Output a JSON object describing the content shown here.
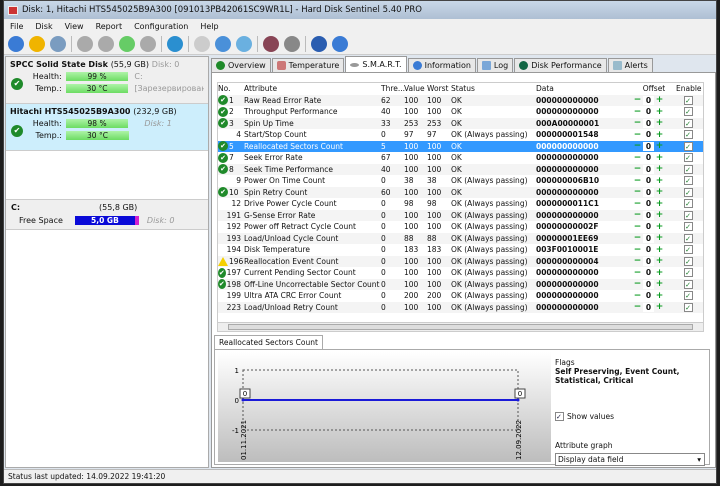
{
  "window": {
    "title": "Disk: 1, Hitachi HTS545025B9A300 [091013PB42061SC9WR1L]  -  Hard Disk Sentinel 5.40 PRO"
  },
  "menu": [
    "File",
    "Disk",
    "View",
    "Report",
    "Configuration",
    "Help"
  ],
  "toolbar_icons": [
    "refresh-icon",
    "alert-icon",
    "disk-icon",
    "disk-test-icon",
    "disk-test-2-icon",
    "disk-ok-icon",
    "disk-remove-icon",
    "globe-icon",
    "document-icon",
    "sync-icon",
    "network-icon",
    "monitor-icon",
    "sound-icon",
    "help-icon",
    "info-icon"
  ],
  "disks": [
    {
      "name": "SPCC Solid State Disk",
      "size": "(55,9 GB)",
      "disk": "Disk: 0",
      "health_label": "Health:",
      "health": "99 %",
      "health_pct": 99,
      "temp_label": "Temp.:",
      "temp": "30 °C",
      "extra1": "C:",
      "extra2": "[Зарезервировано сис"
    },
    {
      "name": "Hitachi HTS545025B9A300",
      "size": "(232,9 GB)",
      "disk": "Disk: 1",
      "health_label": "Health:",
      "health": "98 %",
      "health_pct": 98,
      "temp_label": "Temp.:",
      "temp": "30 °C"
    }
  ],
  "volume": {
    "name": "C:",
    "size": "(55,8 GB)",
    "free_label": "Free Space",
    "free": "5,0 GB",
    "disk": "Disk: 0"
  },
  "tabs": [
    "Overview",
    "Temperature",
    "S.M.A.R.T.",
    "Information",
    "Log",
    "Disk Performance",
    "Alerts"
  ],
  "active_tab": "S.M.A.R.T.",
  "table": {
    "headers": [
      "No.",
      "Attribute",
      "Thre...",
      "Value",
      "Worst",
      "Status",
      "Data",
      "Offset",
      "Enable"
    ],
    "rows": [
      {
        "icon": "ok",
        "no": "1",
        "attr": "Raw Read Error Rate",
        "thr": "62",
        "val": "100",
        "worst": "100",
        "status": "OK",
        "data": "000000000000",
        "offset": "0"
      },
      {
        "icon": "ok",
        "no": "2",
        "attr": "Throughput Performance",
        "thr": "40",
        "val": "100",
        "worst": "100",
        "status": "OK",
        "data": "000000000000",
        "offset": "0"
      },
      {
        "icon": "ok",
        "no": "3",
        "attr": "Spin Up Time",
        "thr": "33",
        "val": "253",
        "worst": "253",
        "status": "OK",
        "data": "000A00000001",
        "offset": "0"
      },
      {
        "icon": "",
        "no": "4",
        "attr": "Start/Stop Count",
        "thr": "0",
        "val": "97",
        "worst": "97",
        "status": "OK (Always passing)",
        "data": "000000001548",
        "offset": "0"
      },
      {
        "icon": "ok",
        "no": "5",
        "attr": "Reallocated Sectors Count",
        "thr": "5",
        "val": "100",
        "worst": "100",
        "status": "OK",
        "data": "000000000000",
        "offset": "0",
        "selected": true
      },
      {
        "icon": "ok",
        "no": "7",
        "attr": "Seek Error Rate",
        "thr": "67",
        "val": "100",
        "worst": "100",
        "status": "OK",
        "data": "000000000000",
        "offset": "0"
      },
      {
        "icon": "ok",
        "no": "8",
        "attr": "Seek Time Performance",
        "thr": "40",
        "val": "100",
        "worst": "100",
        "status": "OK",
        "data": "000000000000",
        "offset": "0"
      },
      {
        "icon": "",
        "no": "9",
        "attr": "Power On Time Count",
        "thr": "0",
        "val": "38",
        "worst": "38",
        "status": "OK (Always passing)",
        "data": "000000006B10",
        "offset": "0"
      },
      {
        "icon": "ok",
        "no": "10",
        "attr": "Spin Retry Count",
        "thr": "60",
        "val": "100",
        "worst": "100",
        "status": "OK",
        "data": "000000000000",
        "offset": "0"
      },
      {
        "icon": "",
        "no": "12",
        "attr": "Drive Power Cycle Count",
        "thr": "0",
        "val": "98",
        "worst": "98",
        "status": "OK (Always passing)",
        "data": "0000000011C1",
        "offset": "0"
      },
      {
        "icon": "",
        "no": "191",
        "attr": "G-Sense Error Rate",
        "thr": "0",
        "val": "100",
        "worst": "100",
        "status": "OK (Always passing)",
        "data": "000000000000",
        "offset": "0"
      },
      {
        "icon": "",
        "no": "192",
        "attr": "Power off Retract Cycle Count",
        "thr": "0",
        "val": "100",
        "worst": "100",
        "status": "OK (Always passing)",
        "data": "00000000002F",
        "offset": "0"
      },
      {
        "icon": "",
        "no": "193",
        "attr": "Load/Unload Cycle Count",
        "thr": "0",
        "val": "88",
        "worst": "88",
        "status": "OK (Always passing)",
        "data": "00000001EE69",
        "offset": "0"
      },
      {
        "icon": "",
        "no": "194",
        "attr": "Disk Temperature",
        "thr": "0",
        "val": "183",
        "worst": "183",
        "status": "OK (Always passing)",
        "data": "003F0010001E",
        "offset": "0"
      },
      {
        "icon": "warn",
        "no": "196",
        "attr": "Reallocation Event Count",
        "thr": "0",
        "val": "100",
        "worst": "100",
        "status": "OK (Always passing)",
        "data": "000000000004",
        "offset": "0"
      },
      {
        "icon": "ok",
        "no": "197",
        "attr": "Current Pending Sector Count",
        "thr": "0",
        "val": "100",
        "worst": "100",
        "status": "OK (Always passing)",
        "data": "000000000000",
        "offset": "0"
      },
      {
        "icon": "ok",
        "no": "198",
        "attr": "Off-Line Uncorrectable Sector Count",
        "thr": "0",
        "val": "100",
        "worst": "100",
        "status": "OK (Always passing)",
        "data": "000000000000",
        "offset": "0"
      },
      {
        "icon": "",
        "no": "199",
        "attr": "Ultra ATA CRC Error Count",
        "thr": "0",
        "val": "200",
        "worst": "200",
        "status": "OK (Always passing)",
        "data": "000000000000",
        "offset": "0"
      },
      {
        "icon": "",
        "no": "223",
        "attr": "Load/Unload Retry Count",
        "thr": "0",
        "val": "100",
        "worst": "100",
        "status": "OK (Always passing)",
        "data": "000000000000",
        "offset": "0"
      }
    ]
  },
  "graph": {
    "tab": "Reallocated Sectors Count",
    "y_ticks": [
      "1",
      "0",
      "-1"
    ],
    "x_labels": [
      "01.11.2021",
      "12.09.2022"
    ],
    "points": [
      {
        "date": "01.11.2021",
        "value": "0"
      },
      {
        "date": "12.09.2022",
        "value": "0"
      }
    ],
    "line_color": "#1a1ad8"
  },
  "side": {
    "flags_label": "Flags",
    "flags": "Self Preserving, Event Count, Statistical, Critical",
    "show_values": "Show values",
    "attr_graph_label": "Attribute graph",
    "attr_graph_value": "Display data field"
  },
  "status": "Status last updated: 14.09.2022 19:41:20"
}
